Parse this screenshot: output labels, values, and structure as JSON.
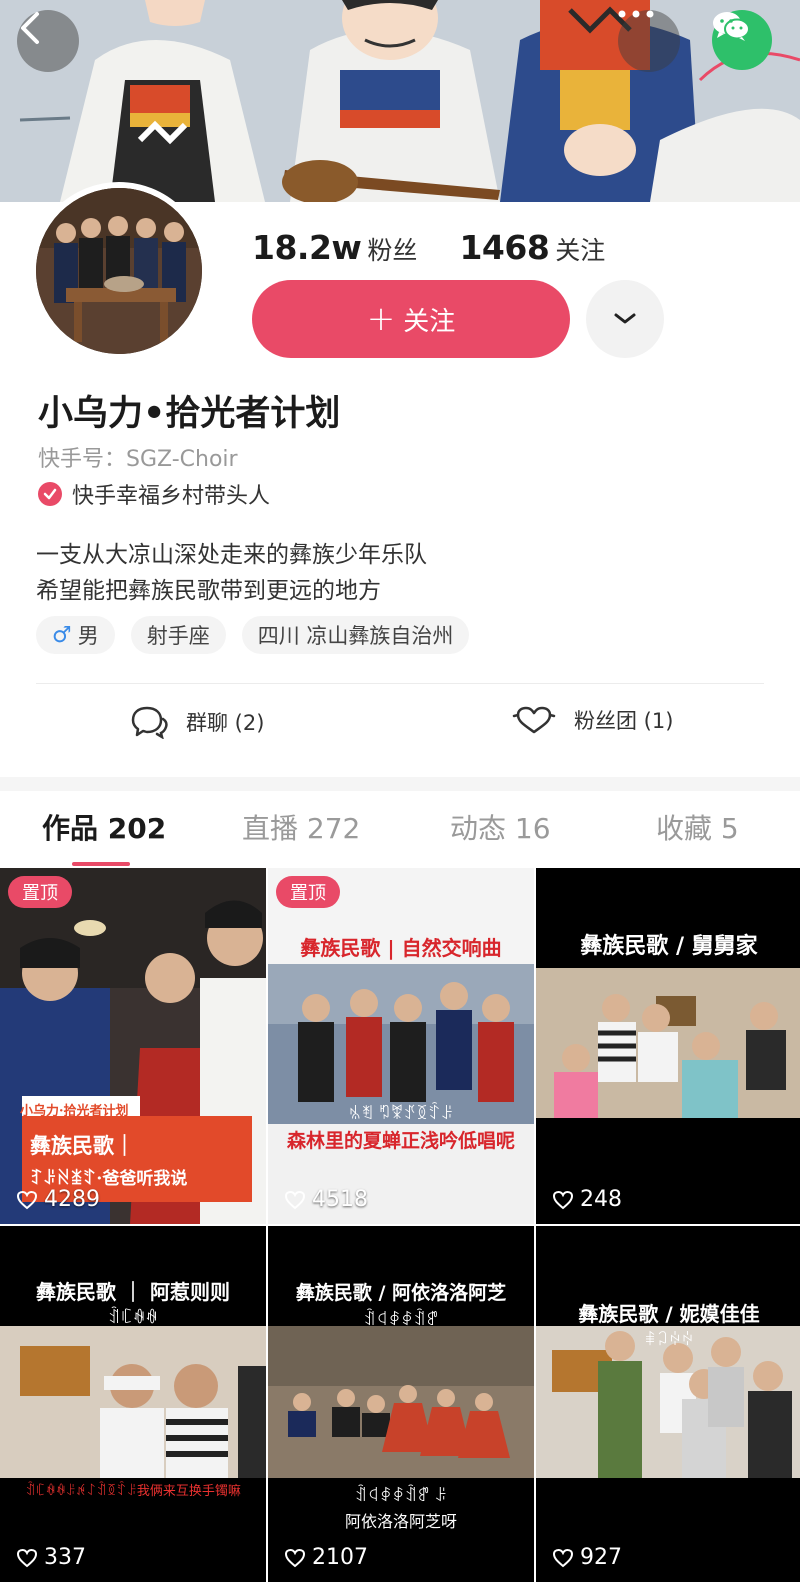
{
  "header": {
    "back_icon": "back-arrow-icon",
    "more_icon": "ellipsis-icon",
    "share_icon": "wechat-icon",
    "wechat_color": "#2ec06a"
  },
  "profile": {
    "followers_count": "18.2w",
    "followers_label": "粉丝",
    "following_count": "1468",
    "following_label": "关注",
    "follow_button_plus": "+",
    "follow_button_label": "关注",
    "name": "小乌力•拾光者计划",
    "kuaishou_id": "快手号：SGZ-Choir",
    "verification": "快手幸福乡村带头人",
    "bio_line1": "一支从大凉山深处走来的彝族少年乐队",
    "bio_line2": "希望能把彝族民歌带到更远的地方",
    "tags": {
      "gender_symbol": "♂",
      "gender": "男",
      "zodiac": "射手座",
      "location": "四川 凉山彝族自治州"
    },
    "accent_color": "#e94a67"
  },
  "social": {
    "group_chat": "群聊 (2)",
    "fan_club": "粉丝团 (1)"
  },
  "tabs": [
    {
      "label": "作品 202"
    },
    {
      "label": "直播 272"
    },
    {
      "label": "动态 16"
    },
    {
      "label": "收藏 5"
    }
  ],
  "videos": [
    {
      "pinned": "置顶",
      "likes": "4289",
      "title_a": "小乌力·拾光者计划",
      "title_b": "彝族民歌｜",
      "title_c": "ꆈꌠꋊꁧꄸ·爸爸听我说"
    },
    {
      "pinned": "置顶",
      "likes": "4518",
      "title_a": "彝族民歌 | 自然交响曲",
      "caption_b": "ꁱꄮ ꑳꐗꀋꅉꄷꌠ",
      "caption_c": "森林里的夏蝉正浅吟低唱呢"
    },
    {
      "likes": "248",
      "title_a": "彝族民歌 / 舅舅家"
    },
    {
      "likes": "337",
      "title_a": "彝族民歌 ｜ 阿惹则则",
      "sub_a": "ꀉꏸꊿꊿ",
      "caption_c": "ꀉꏸꊿꊿꌠꉌꋍꀉꅉꄷꌠ我俩来互换手镯嘛"
    },
    {
      "likes": "2107",
      "title_a": "彝族民歌 / 阿依洛洛阿芝",
      "sub_a": "ꀉꒉꇉꇉꀉꍗ",
      "caption_b": "ꀉꒉꇉꇉꀉꍗ ꌠ",
      "caption_c": "阿依洛洛阿芝呀"
    },
    {
      "likes": "927",
      "title_a": "彝族民歌 / 妮嫫佳佳",
      "sub_a": "ꑌꃀꏢꏢ"
    }
  ]
}
